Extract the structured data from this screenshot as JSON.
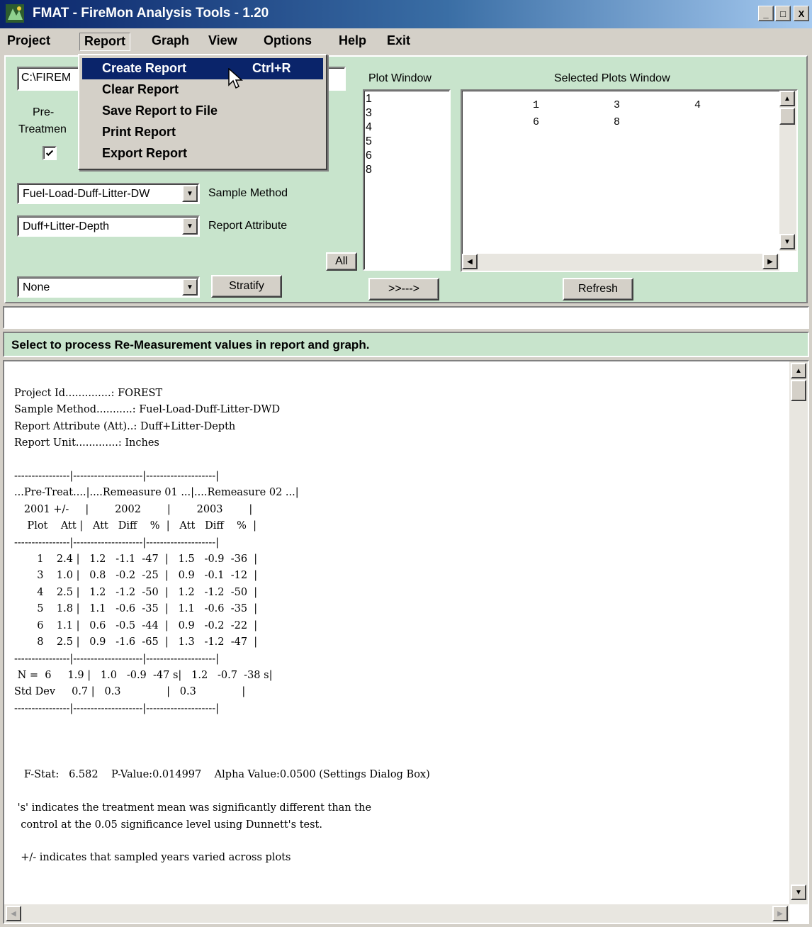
{
  "window": {
    "title": "FMAT - FireMon Analysis Tools - 1.20",
    "minimize": "_",
    "maximize": "□",
    "close": "X"
  },
  "menu": [
    "Project",
    "Report",
    "Graph",
    "View",
    "Options",
    "Help",
    "Exit"
  ],
  "report_menu": {
    "items": [
      {
        "label": "Create Report",
        "accel": "Ctrl+R"
      },
      {
        "label": "Clear Report",
        "accel": ""
      },
      {
        "label": "Save Report to File",
        "accel": ""
      },
      {
        "label": "Print Report",
        "accel": ""
      },
      {
        "label": "Export Report",
        "accel": ""
      }
    ]
  },
  "panel": {
    "path_value": "C:\\FIREM",
    "pretreatment_label_1": "Pre-",
    "pretreatment_label_2": "Treatmen",
    "pretreatment_checked": "☑",
    "sample_method_value": "Fuel-Load-Duff-Litter-DW",
    "sample_method_label": "Sample Method",
    "report_attribute_value": "Duff+Litter-Depth",
    "report_attribute_label": "Report Attribute",
    "stratify_value": "None",
    "stratify_button": "Stratify",
    "all_button": "All",
    "plot_window_label": "Plot Window",
    "plot_list": [
      "1",
      "3",
      "4",
      "5",
      "6",
      "8"
    ],
    "move_button": ">>--->",
    "selected_label": "Selected Plots Window",
    "selected_plots": [
      "1",
      "3",
      "4",
      "6",
      "8"
    ],
    "refresh_button": "Refresh"
  },
  "hint": "Select to process Re-Measurement values in report and graph.",
  "report": {
    "lines": [
      "Project Id..............: FOREST",
      "Sample Method...........: Fuel-Load-Duff-Litter-DWD",
      "Report Attribute (Att)..: Duff+Litter-Depth",
      "Report Unit.............: Inches",
      "",
      "----------------|--------------------|--------------------|",
      "...Pre-Treat....|....Remeasure 01 ...|....Remeasure 02 ...|",
      "   2001 +/-     |        2002        |        2003        |",
      "    Plot    Att |   Att   Diff    %  |   Att   Diff    %  |",
      "----------------|--------------------|--------------------|",
      "       1    2.4 |   1.2   -1.1  -47  |   1.5   -0.9  -36  |",
      "       3    1.0 |   0.8   -0.2  -25  |   0.9   -0.1  -12  |",
      "       4    2.5 |   1.2   -1.2  -50  |   1.2   -1.2  -50  |",
      "       5    1.8 |   1.1   -0.6  -35  |   1.1   -0.6  -35  |",
      "       6    1.1 |   0.6   -0.5  -44  |   0.9   -0.2  -22  |",
      "       8    2.5 |   0.9   -1.6  -65  |   1.3   -1.2  -47  |",
      "----------------|--------------------|--------------------|",
      " N =  6     1.9 |   1.0   -0.9  -47 s|   1.2   -0.7  -38 s|",
      "Std Dev     0.7 |   0.3              |   0.3              |",
      "----------------|--------------------|--------------------|",
      "",
      "",
      "",
      "   F-Stat:   6.582    P-Value:0.014997    Alpha Value:0.0500 (Settings Dialog Box)",
      "",
      " 's' indicates the treatment mean was significantly different than the",
      "  control at the 0.05 significance level using Dunnett's test.",
      "",
      "  +/- indicates that sampled years varied across plots"
    ]
  },
  "colors": {
    "panel_green": "#c8e4cc",
    "menu_highlight": "#0a246a",
    "title_blue": "#0a246a"
  },
  "icons": {
    "app": "fmat-app-icon",
    "cursor": "mouse-pointer-icon",
    "checkbox": "checkbox-icon"
  }
}
